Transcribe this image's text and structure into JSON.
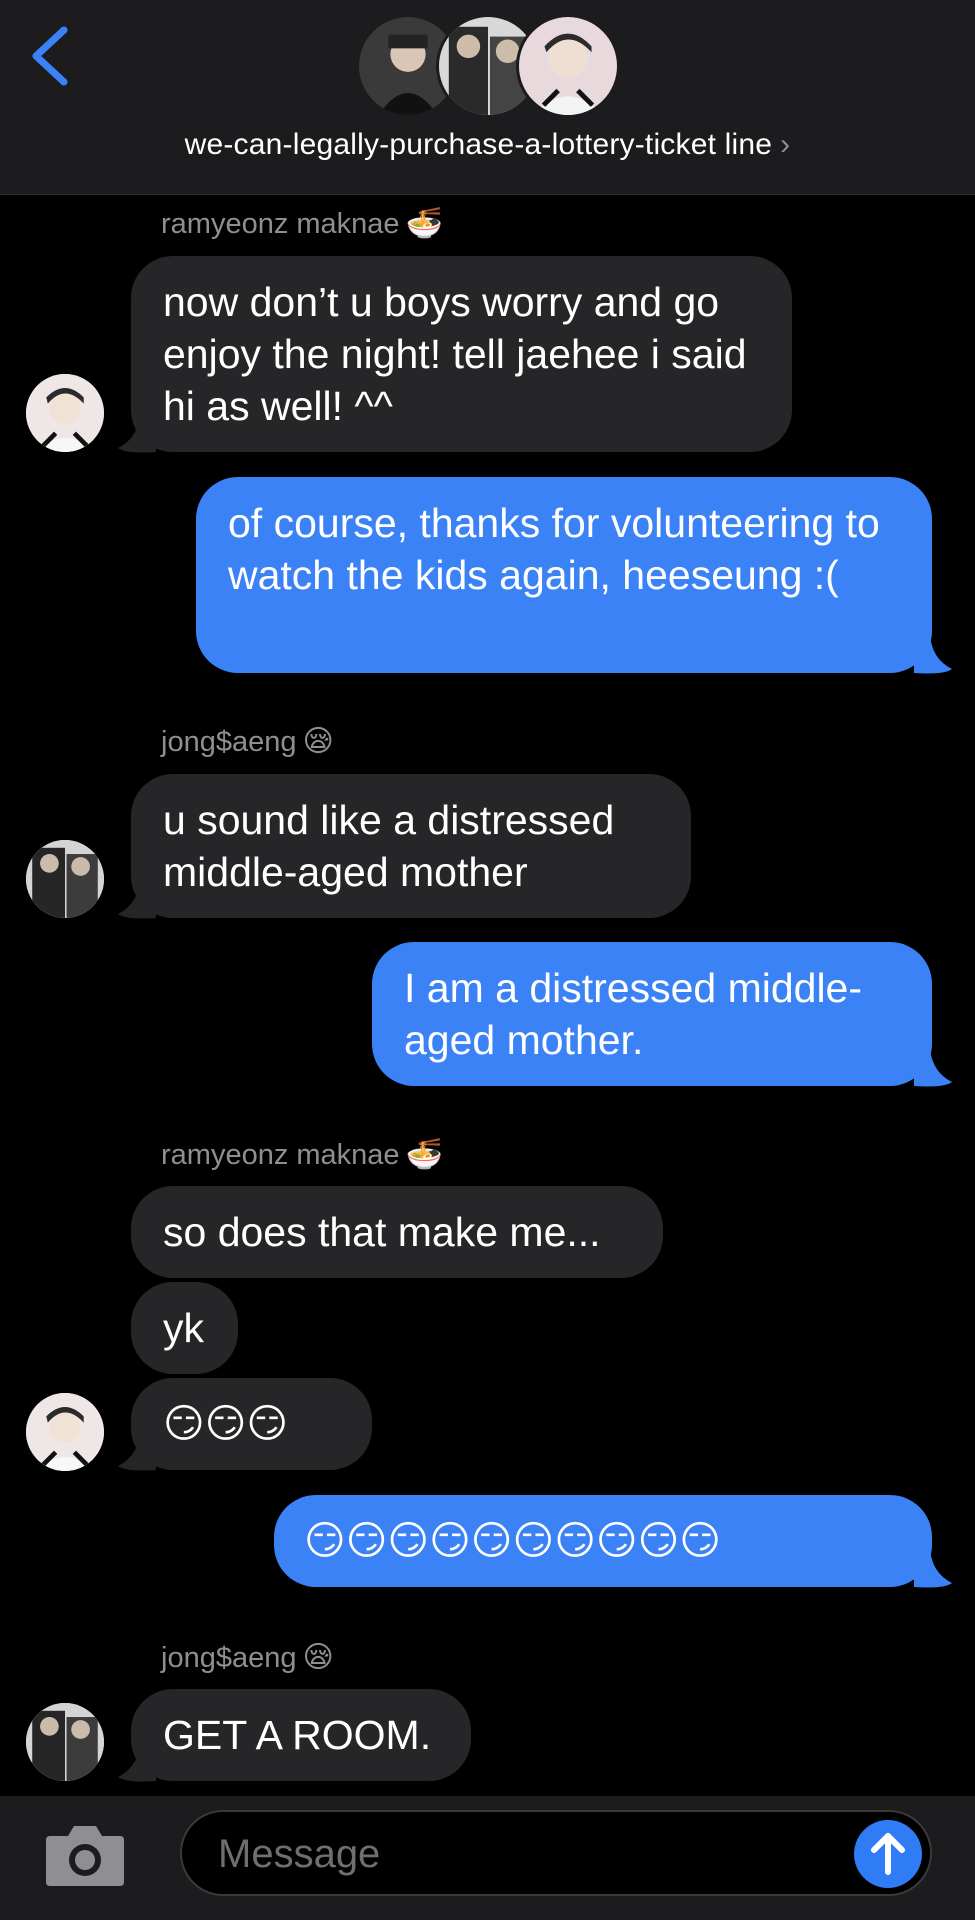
{
  "header": {
    "back_icon": "chevron-left-icon",
    "group_name": "we-can-legally-purchase-a-lottery-ticket line",
    "chevron": "›"
  },
  "colors": {
    "accent": "#3b82f6",
    "incoming_bubble": "#262628",
    "header_bg": "#1c1c1e",
    "sender_name": "#8e8e93"
  },
  "messages": [
    {
      "sender": "ramyeonz maknae",
      "sender_emoji": "🍜",
      "direction": "in",
      "text": "now don’t u boys worry and go enjoy the night! tell jaehee i said hi as well! ^^"
    },
    {
      "direction": "out",
      "text": "of course, thanks for volunteering to watch the kids again, heeseung :("
    },
    {
      "sender": "jong$aeng",
      "sender_emoji": "😪",
      "direction": "in",
      "text": "u sound like a distressed middle-aged mother"
    },
    {
      "direction": "out",
      "text": "I am a distressed middle-aged mother."
    },
    {
      "sender": "ramyeonz maknae",
      "sender_emoji": "🍜",
      "direction": "in",
      "text": "so does that make me..."
    },
    {
      "direction": "in",
      "text": "yk"
    },
    {
      "direction": "in",
      "text": "😏😏😏"
    },
    {
      "direction": "out",
      "text": "😏😏😏😏😏😏😏😏😏😏"
    },
    {
      "sender": "jong$aeng",
      "sender_emoji": "😪",
      "direction": "in",
      "text": "GET A ROOM."
    }
  ],
  "composer": {
    "camera_icon": "camera-icon",
    "placeholder": "Message",
    "send_icon": "arrow-up-icon"
  }
}
